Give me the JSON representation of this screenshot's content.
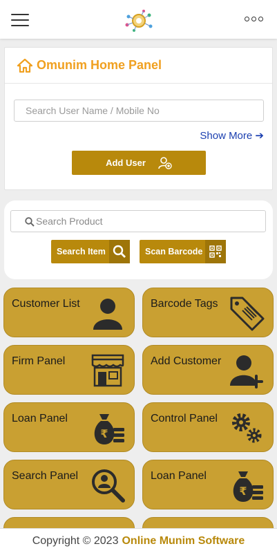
{
  "header": {
    "menu_icon": "hamburger-icon",
    "logo_icon": "app-logo",
    "more_icon": "more-options-icon"
  },
  "home_panel": {
    "title": "Omunim Home Panel",
    "title_icon": "home-icon",
    "search_user_placeholder": "Search User Name / Mobile No",
    "show_more": "Show More",
    "show_more_icon": "arrow-right-icon",
    "add_user_label": "Add User",
    "add_user_icon": "user-add-icon"
  },
  "product_search": {
    "placeholder": "Search Product",
    "search_item_label": "Search Item",
    "scan_barcode_label": "Scan Barcode"
  },
  "tiles": [
    {
      "label": "Customer List",
      "icon": "user-icon"
    },
    {
      "label": "Barcode Tags",
      "icon": "barcode-tag-icon"
    },
    {
      "label": "Firm Panel",
      "icon": "storefront-icon"
    },
    {
      "label": "Add Customer",
      "icon": "user-plus-icon"
    },
    {
      "label": "Loan Panel",
      "icon": "money-bag-icon"
    },
    {
      "label": "Control Panel",
      "icon": "gears-icon"
    },
    {
      "label": "Search Panel",
      "icon": "search-user-icon"
    },
    {
      "label": "Loan Panel",
      "icon": "money-bag-icon"
    }
  ],
  "footer": {
    "copyright": "Copyright © 2023",
    "brand": "Online Munim Software"
  },
  "colors": {
    "accent_gold": "#b8890c",
    "tile_gold": "#c9a032",
    "title_orange": "#f0a020",
    "link_blue": "#1b3fb0"
  }
}
